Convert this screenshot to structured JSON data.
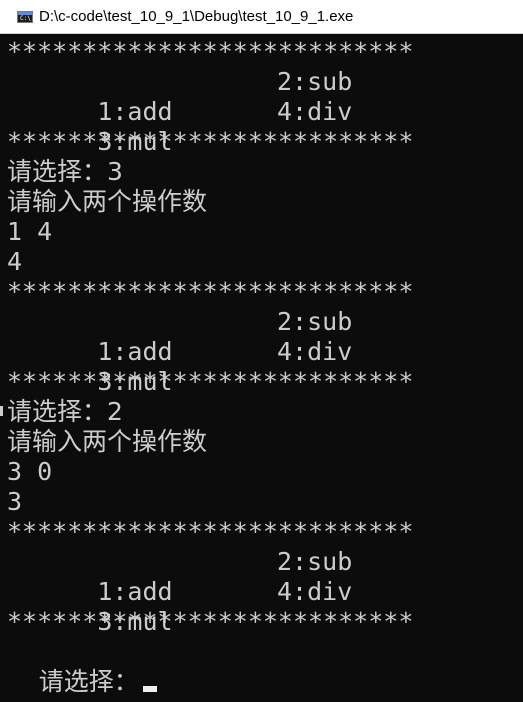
{
  "window": {
    "title": "D:\\c-code\\test_10_9_1\\Debug\\test_10_9_1.exe",
    "icon_label": "C:\\"
  },
  "menu": {
    "border": "***************************",
    "add": "  1:add",
    "sub": "2:sub",
    "mul": "  3:mul",
    "div": "4:div"
  },
  "session": {
    "choice_1": "请选择：3",
    "prompt_1": "请输入两个操作数",
    "operands_1": "1 4",
    "result_1": "4",
    "choice_2": "请选择：2",
    "prompt_2": "请输入两个操作数",
    "operands_2": "3 0",
    "result_2": "3",
    "choice_3": "请选择："
  },
  "colors": {
    "console_bg": "#0c0c0c",
    "console_fg": "#cccccc",
    "titlebar_bg": "#ffffff"
  }
}
